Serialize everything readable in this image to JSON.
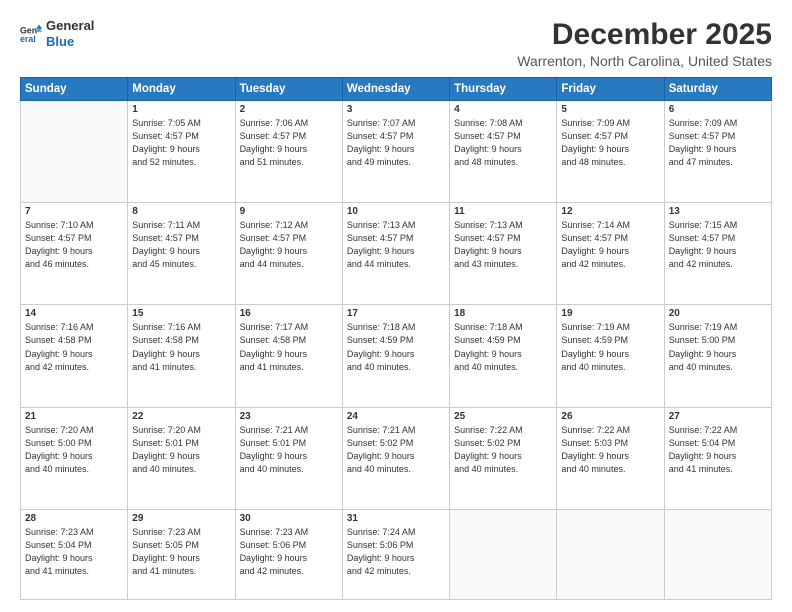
{
  "header": {
    "logo_line1": "General",
    "logo_line2": "Blue",
    "title": "December 2025",
    "subtitle": "Warrenton, North Carolina, United States"
  },
  "columns": [
    "Sunday",
    "Monday",
    "Tuesday",
    "Wednesday",
    "Thursday",
    "Friday",
    "Saturday"
  ],
  "weeks": [
    [
      {
        "day": "",
        "info": ""
      },
      {
        "day": "1",
        "info": "Sunrise: 7:05 AM\nSunset: 4:57 PM\nDaylight: 9 hours\nand 52 minutes."
      },
      {
        "day": "2",
        "info": "Sunrise: 7:06 AM\nSunset: 4:57 PM\nDaylight: 9 hours\nand 51 minutes."
      },
      {
        "day": "3",
        "info": "Sunrise: 7:07 AM\nSunset: 4:57 PM\nDaylight: 9 hours\nand 49 minutes."
      },
      {
        "day": "4",
        "info": "Sunrise: 7:08 AM\nSunset: 4:57 PM\nDaylight: 9 hours\nand 48 minutes."
      },
      {
        "day": "5",
        "info": "Sunrise: 7:09 AM\nSunset: 4:57 PM\nDaylight: 9 hours\nand 48 minutes."
      },
      {
        "day": "6",
        "info": "Sunrise: 7:09 AM\nSunset: 4:57 PM\nDaylight: 9 hours\nand 47 minutes."
      }
    ],
    [
      {
        "day": "7",
        "info": "Sunrise: 7:10 AM\nSunset: 4:57 PM\nDaylight: 9 hours\nand 46 minutes."
      },
      {
        "day": "8",
        "info": "Sunrise: 7:11 AM\nSunset: 4:57 PM\nDaylight: 9 hours\nand 45 minutes."
      },
      {
        "day": "9",
        "info": "Sunrise: 7:12 AM\nSunset: 4:57 PM\nDaylight: 9 hours\nand 44 minutes."
      },
      {
        "day": "10",
        "info": "Sunrise: 7:13 AM\nSunset: 4:57 PM\nDaylight: 9 hours\nand 44 minutes."
      },
      {
        "day": "11",
        "info": "Sunrise: 7:13 AM\nSunset: 4:57 PM\nDaylight: 9 hours\nand 43 minutes."
      },
      {
        "day": "12",
        "info": "Sunrise: 7:14 AM\nSunset: 4:57 PM\nDaylight: 9 hours\nand 42 minutes."
      },
      {
        "day": "13",
        "info": "Sunrise: 7:15 AM\nSunset: 4:57 PM\nDaylight: 9 hours\nand 42 minutes."
      }
    ],
    [
      {
        "day": "14",
        "info": "Sunrise: 7:16 AM\nSunset: 4:58 PM\nDaylight: 9 hours\nand 42 minutes."
      },
      {
        "day": "15",
        "info": "Sunrise: 7:16 AM\nSunset: 4:58 PM\nDaylight: 9 hours\nand 41 minutes."
      },
      {
        "day": "16",
        "info": "Sunrise: 7:17 AM\nSunset: 4:58 PM\nDaylight: 9 hours\nand 41 minutes."
      },
      {
        "day": "17",
        "info": "Sunrise: 7:18 AM\nSunset: 4:59 PM\nDaylight: 9 hours\nand 40 minutes."
      },
      {
        "day": "18",
        "info": "Sunrise: 7:18 AM\nSunset: 4:59 PM\nDaylight: 9 hours\nand 40 minutes."
      },
      {
        "day": "19",
        "info": "Sunrise: 7:19 AM\nSunset: 4:59 PM\nDaylight: 9 hours\nand 40 minutes."
      },
      {
        "day": "20",
        "info": "Sunrise: 7:19 AM\nSunset: 5:00 PM\nDaylight: 9 hours\nand 40 minutes."
      }
    ],
    [
      {
        "day": "21",
        "info": "Sunrise: 7:20 AM\nSunset: 5:00 PM\nDaylight: 9 hours\nand 40 minutes."
      },
      {
        "day": "22",
        "info": "Sunrise: 7:20 AM\nSunset: 5:01 PM\nDaylight: 9 hours\nand 40 minutes."
      },
      {
        "day": "23",
        "info": "Sunrise: 7:21 AM\nSunset: 5:01 PM\nDaylight: 9 hours\nand 40 minutes."
      },
      {
        "day": "24",
        "info": "Sunrise: 7:21 AM\nSunset: 5:02 PM\nDaylight: 9 hours\nand 40 minutes."
      },
      {
        "day": "25",
        "info": "Sunrise: 7:22 AM\nSunset: 5:02 PM\nDaylight: 9 hours\nand 40 minutes."
      },
      {
        "day": "26",
        "info": "Sunrise: 7:22 AM\nSunset: 5:03 PM\nDaylight: 9 hours\nand 40 minutes."
      },
      {
        "day": "27",
        "info": "Sunrise: 7:22 AM\nSunset: 5:04 PM\nDaylight: 9 hours\nand 41 minutes."
      }
    ],
    [
      {
        "day": "28",
        "info": "Sunrise: 7:23 AM\nSunset: 5:04 PM\nDaylight: 9 hours\nand 41 minutes."
      },
      {
        "day": "29",
        "info": "Sunrise: 7:23 AM\nSunset: 5:05 PM\nDaylight: 9 hours\nand 41 minutes."
      },
      {
        "day": "30",
        "info": "Sunrise: 7:23 AM\nSunset: 5:06 PM\nDaylight: 9 hours\nand 42 minutes."
      },
      {
        "day": "31",
        "info": "Sunrise: 7:24 AM\nSunset: 5:06 PM\nDaylight: 9 hours\nand 42 minutes."
      },
      {
        "day": "",
        "info": ""
      },
      {
        "day": "",
        "info": ""
      },
      {
        "day": "",
        "info": ""
      }
    ]
  ]
}
